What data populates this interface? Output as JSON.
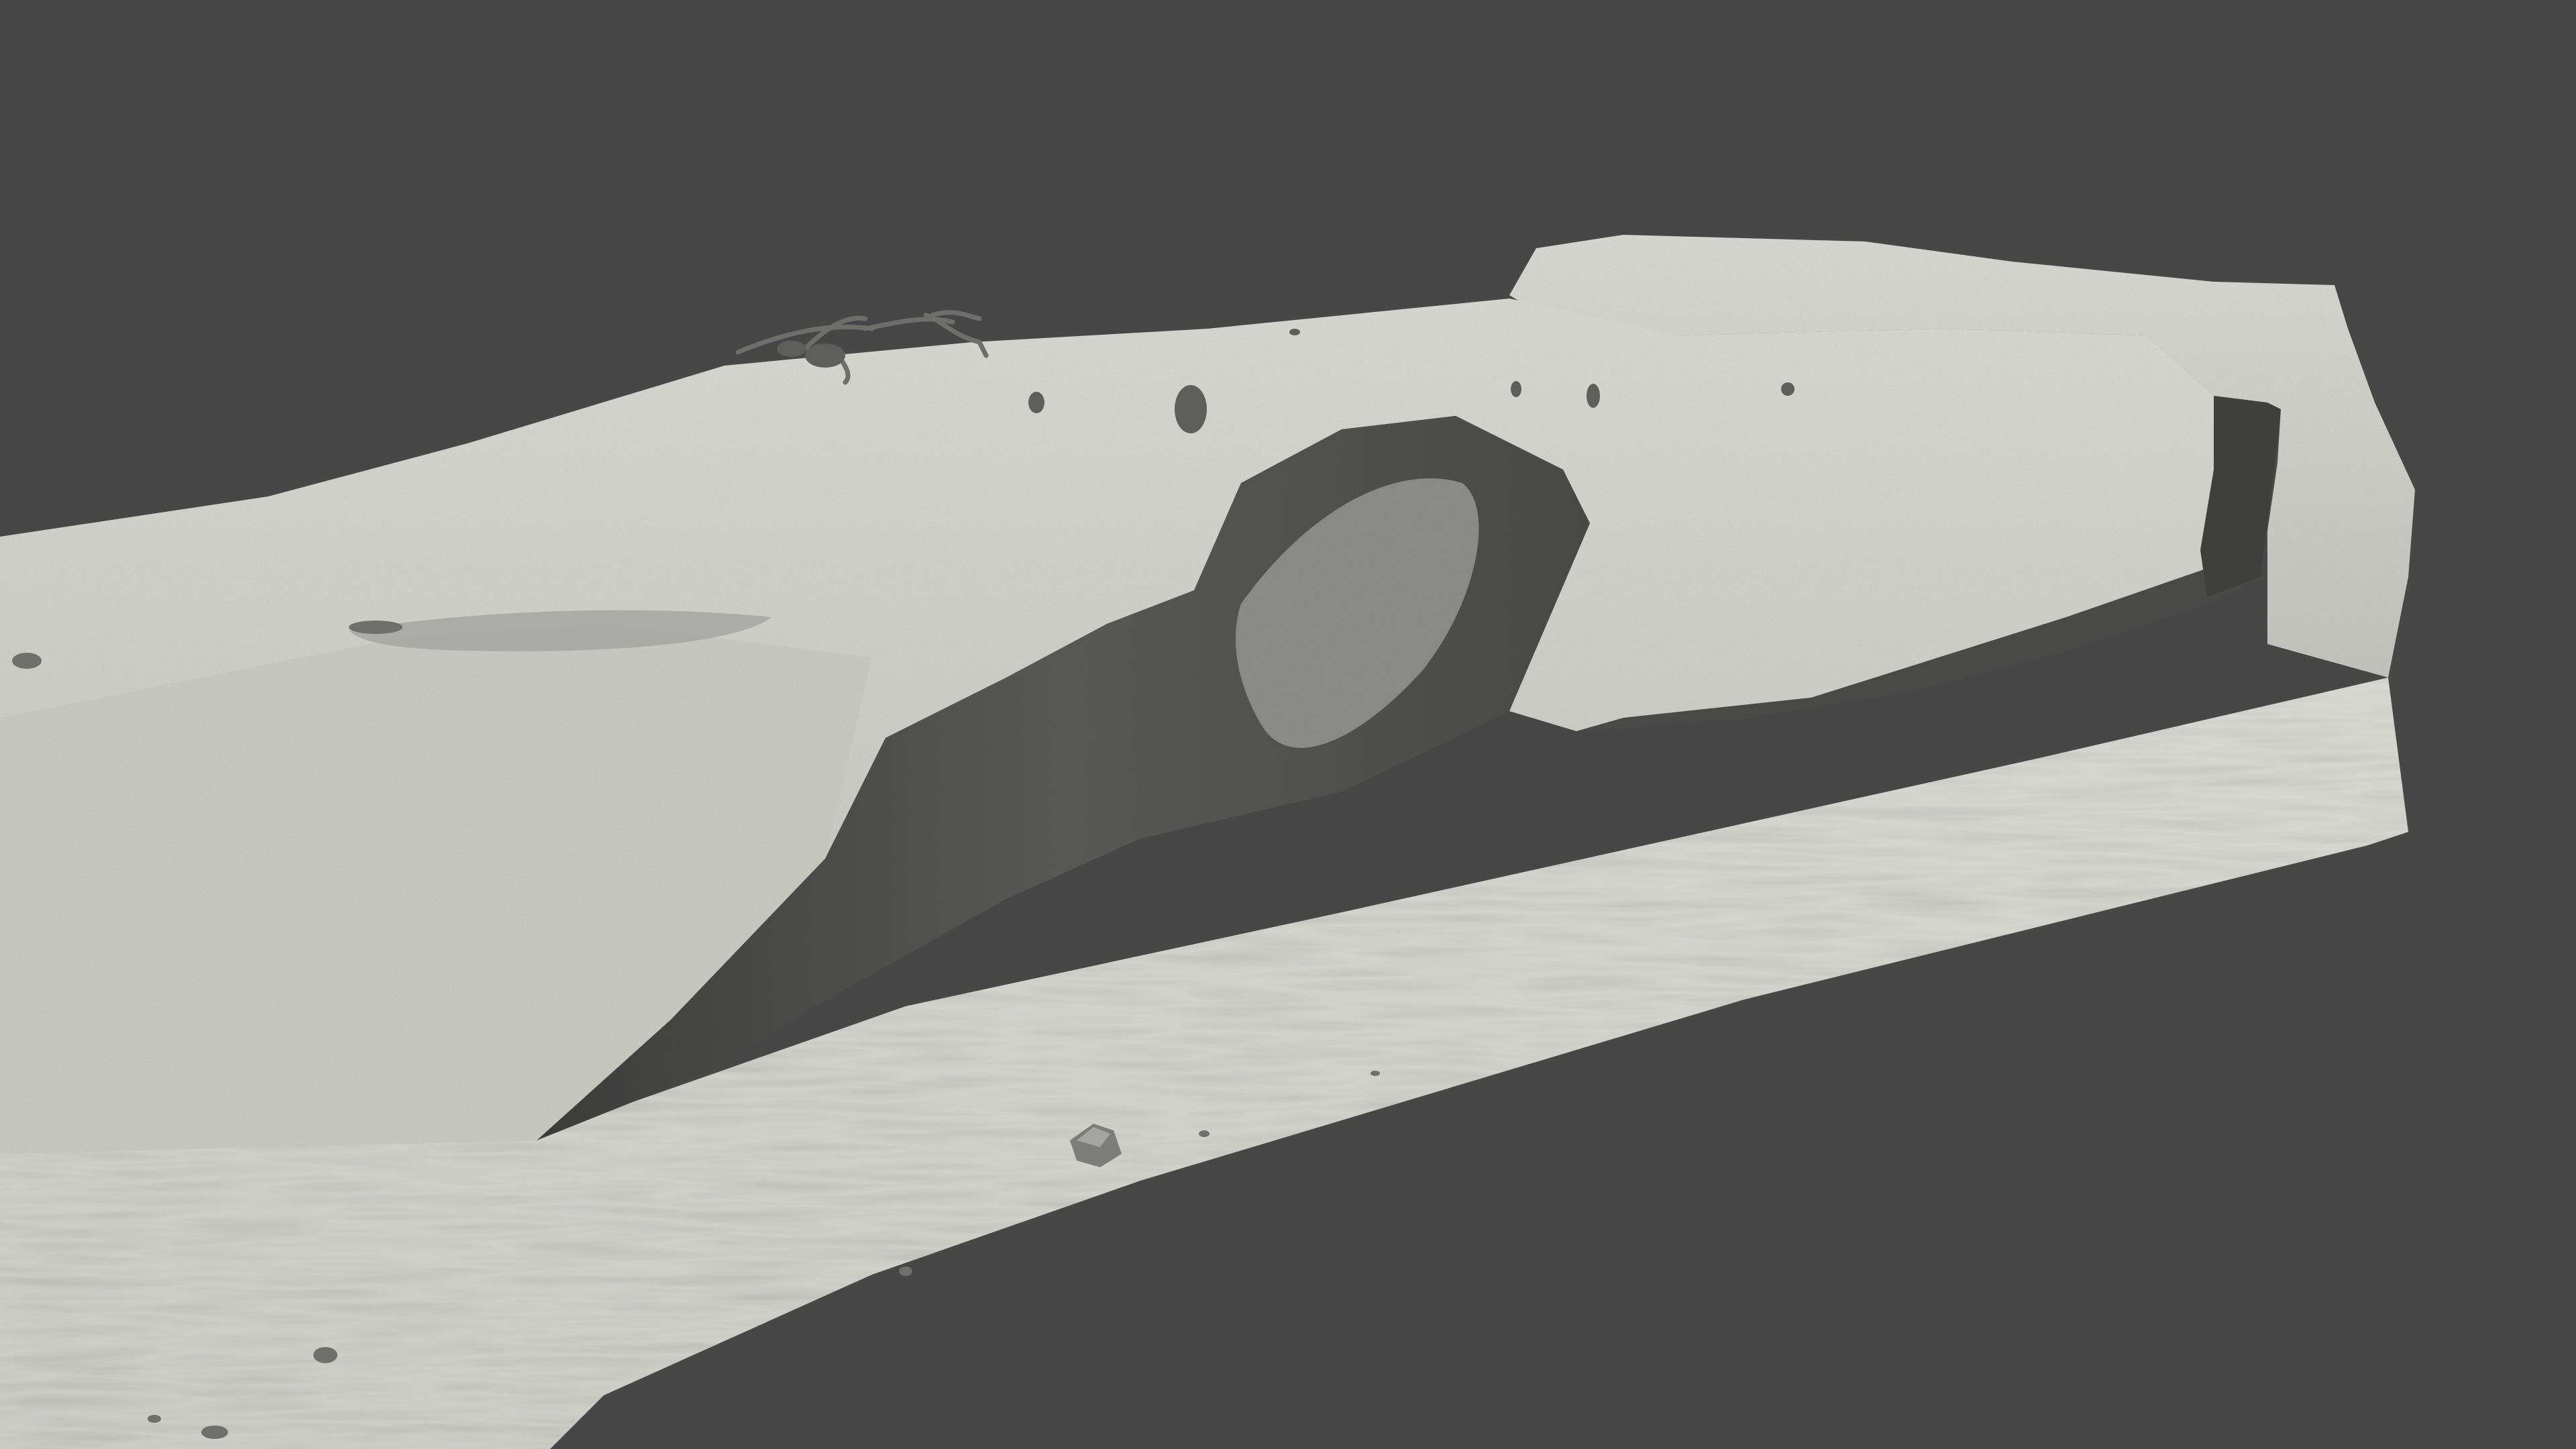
{
  "scene": {
    "subject": "3d-terrain-mesh",
    "render_style": "grey clay shaded mesh",
    "colors": {
      "background": "#474747",
      "surface_light": "#d4d4cf",
      "surface_mid": "#b7b7b2",
      "surface_shadow": "#575756",
      "surface_deep_shadow": "#3f3f3e",
      "debris": "#6e6e6b"
    }
  }
}
